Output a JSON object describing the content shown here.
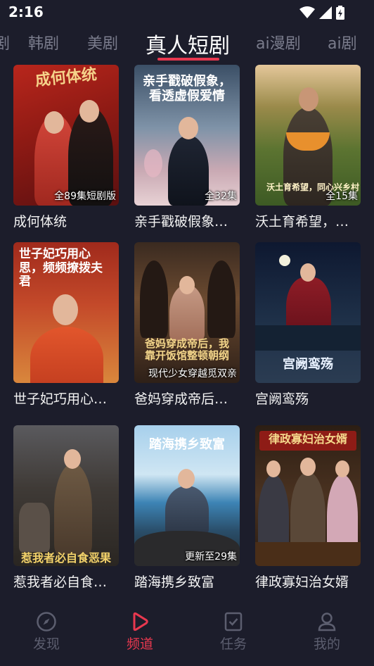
{
  "status": {
    "time": "2:16"
  },
  "tabs": [
    {
      "label": "剧"
    },
    {
      "label": "韩剧"
    },
    {
      "label": "美剧"
    },
    {
      "label": "真人短剧",
      "active": true
    },
    {
      "label": "ai漫剧"
    },
    {
      "label": "ai剧"
    }
  ],
  "cards": [
    {
      "title": "成何体统",
      "poster_text": "成何体统",
      "badge": "全89集短剧版",
      "icon": "couple-poster"
    },
    {
      "title": "亲手戳破假象，看透虚假爱情",
      "poster_text": "亲手戳破假象，看透虚假爱情",
      "badge": "全32集",
      "icon": "man-suit-poster"
    },
    {
      "title": "沃土育希望，同心兴乡村",
      "poster_text": "沃土育希望，同心兴乡村",
      "badge": "全15集",
      "icon": "farmer-poster"
    },
    {
      "title": "世子妃巧用心思，频频撩拨夫君",
      "poster_text": "世子妃巧用心思，频频撩拨夫君",
      "badge": "",
      "icon": "princess-poster"
    },
    {
      "title": "爸妈穿成帝后，我靠开饭馆整顿朝纲",
      "poster_text": "爸妈穿成帝后，我靠开饭馆整顿朝纲",
      "badge": "现代少女穿越觅双亲",
      "icon": "palace-poster"
    },
    {
      "title": "宫阙鸾殇",
      "poster_text": "宫阙鸾殇",
      "badge": "",
      "icon": "night-palace-poster"
    },
    {
      "title": "惹我者必自食恶果",
      "poster_text": "惹我者必自食恶果",
      "badge": "",
      "icon": "village-girl-poster"
    },
    {
      "title": "踏海携乡致富",
      "poster_text": "踏海携乡致富",
      "badge": "更新至29集",
      "icon": "seaside-poster"
    },
    {
      "title": "律政寡妇治女婿",
      "poster_text": "律政寡妇治女婿",
      "badge": "",
      "icon": "court-poster"
    }
  ],
  "nav": [
    {
      "label": "发现",
      "icon": "compass-icon"
    },
    {
      "label": "频道",
      "icon": "play-icon",
      "active": true
    },
    {
      "label": "任务",
      "icon": "task-icon"
    },
    {
      "label": "我的",
      "icon": "profile-icon"
    }
  ],
  "colors": {
    "background": "#1c1d2b",
    "accent": "#e8384f",
    "inactive": "#5c5e6f"
  }
}
